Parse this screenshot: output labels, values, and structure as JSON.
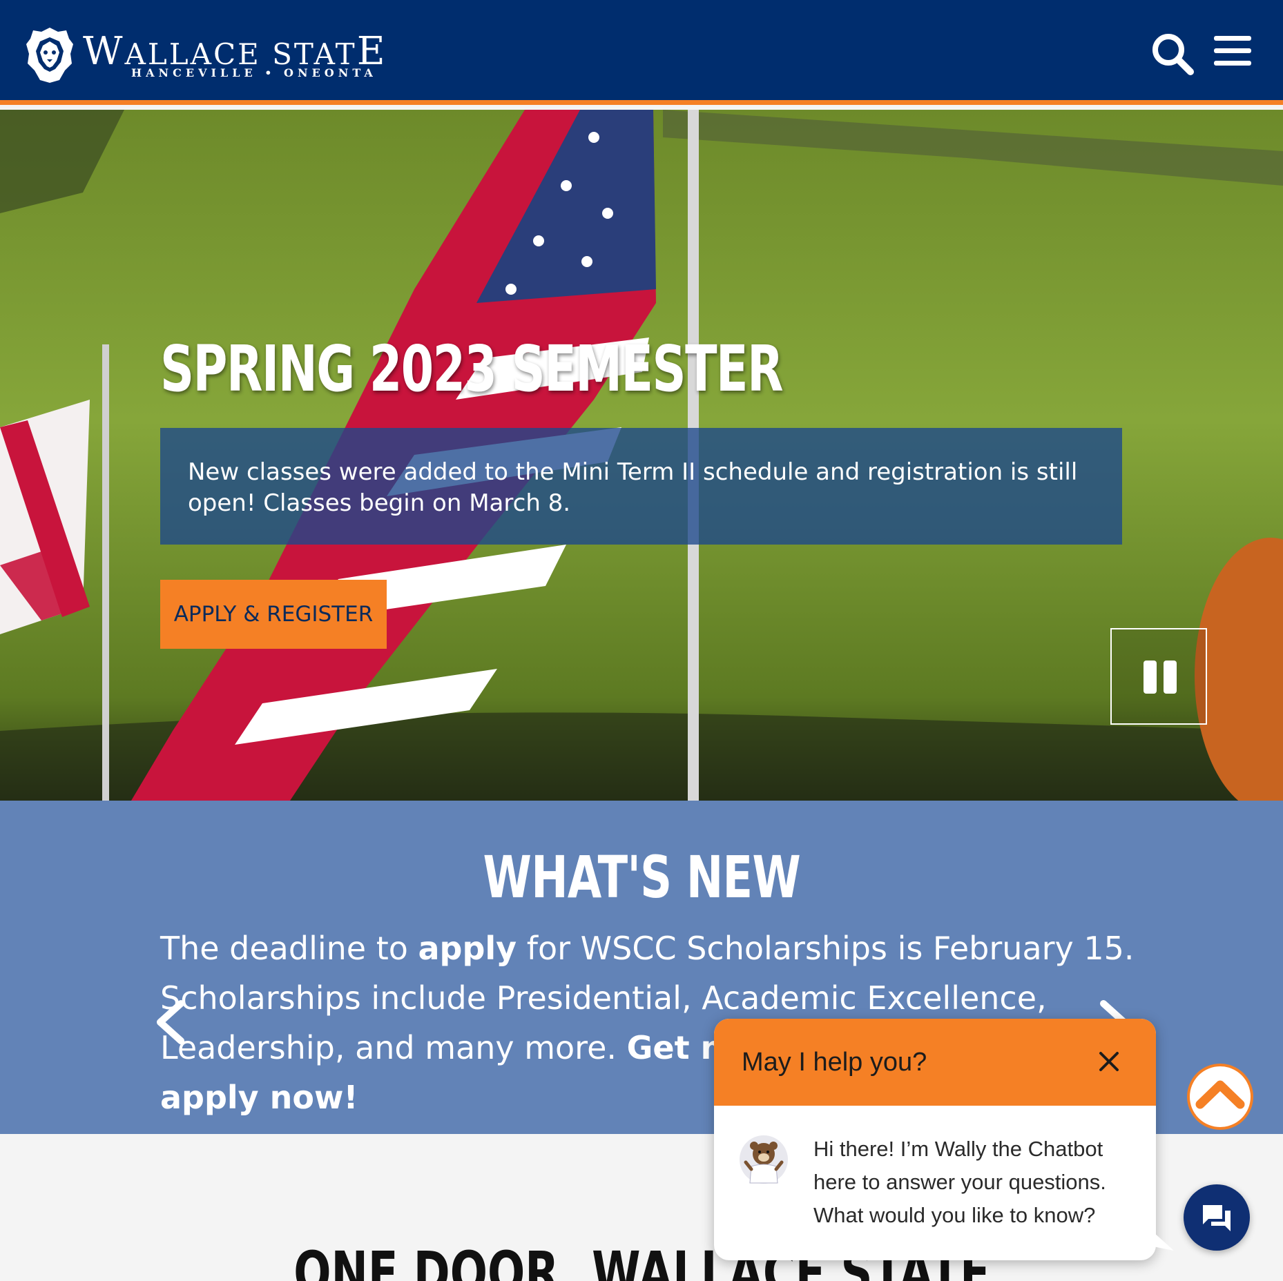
{
  "header": {
    "logo_name_first": "W",
    "logo_name_rest": "ALLACE STAT",
    "logo_name_last": "E",
    "logo_subtitle": "HANCEVILLE • ONEONTA",
    "search_icon": "search-icon",
    "menu_icon": "hamburger-menu-icon"
  },
  "colors": {
    "navy": "#002d6e",
    "orange": "#f58025",
    "news_blue": "#6283b7",
    "chat_launcher": "#0f2f73"
  },
  "hero": {
    "title": "SPRING 2023 SEMESTER",
    "description": "New classes were added to the Mini Term II schedule and registration is still open! Classes begin on March 8.",
    "button_label": "APPLY & REGISTER",
    "pause_icon": "pause-icon"
  },
  "news": {
    "title": "WHAT'S NEW",
    "text_1": "The deadline to ",
    "text_bold_1": "apply",
    "text_2": " for WSCC Scholarships is February 15. Scholarships include Presidential, Academic Excellence, Leadership, and many more. ",
    "text_bold_2": "Get more information and apply now!",
    "prev_icon": "chevron-left-icon",
    "next_icon": "chevron-right-icon"
  },
  "onedoor": {
    "title": "ONE DOOR, WALLACE STATE"
  },
  "chat": {
    "title": "May I help you?",
    "message": "Hi there! I’m Wally the Chatbot here to answer your questions. What would you like to know?",
    "close_icon": "close-icon",
    "avatar_icon": "mascot-avatar-icon",
    "launcher_icon": "chat-bubble-icon",
    "scroll_top_icon": "chevron-up-icon"
  }
}
